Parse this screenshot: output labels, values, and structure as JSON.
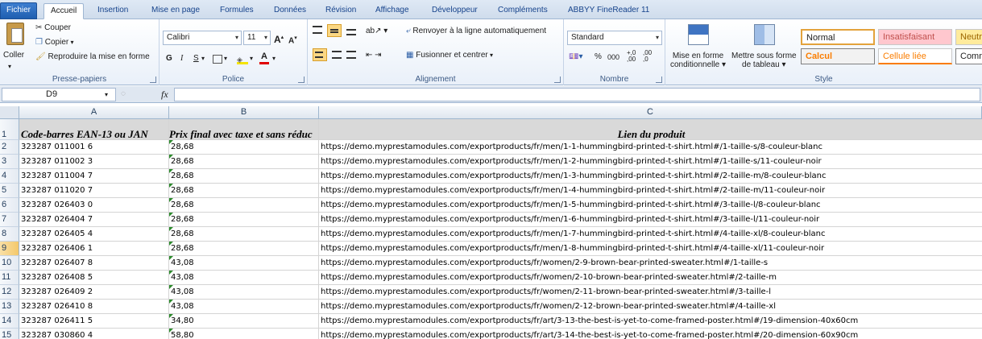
{
  "ribbon_tabs": [
    "Fichier",
    "Accueil",
    "Insertion",
    "Mise en page",
    "Formules",
    "Données",
    "Révision",
    "Affichage",
    "Développeur",
    "Compléments",
    "ABBYY FineReader 11"
  ],
  "clipboard": {
    "paste": "Coller",
    "cut": "Couper",
    "copy": "Copier",
    "format_painter": "Reproduire la mise en forme",
    "label": "Presse-papiers"
  },
  "font": {
    "name": "Calibri",
    "size": "11",
    "bold": "G",
    "italic": "I",
    "underline": "S",
    "label": "Police"
  },
  "alignment": {
    "wrap": "Renvoyer à la ligne automatiquement",
    "merge": "Fusionner et centrer",
    "label": "Alignement"
  },
  "number": {
    "format": "Standard",
    "percent": "%",
    "thousands": "000",
    "label": "Nombre"
  },
  "styles": {
    "cond_format_1": "Mise en forme",
    "cond_format_2": "conditionnelle",
    "table_format_1": "Mettre sous forme",
    "table_format_2": "de tableau",
    "normal": "Normal",
    "bad": "Insatisfaisant",
    "neutral": "Neutr",
    "calc": "Calcul",
    "linked": "Cellule liée",
    "comment": "Comm",
    "label": "Style"
  },
  "formula_bar": {
    "cell_ref": "D9",
    "fx": "fx",
    "value": ""
  },
  "columns": [
    "A",
    "B",
    "C"
  ],
  "selected_row": "9",
  "header_row": {
    "row": "1",
    "a": "Code-barres EAN-13 ou JAN",
    "b": "Prix final avec taxe et sans réduc",
    "c": "Lien du produit"
  },
  "rows": [
    {
      "n": "2",
      "a": "323287 011001 6",
      "b": "28,68",
      "c": "https://demo.myprestamodules.com/exportproducts/fr/men/1-1-hummingbird-printed-t-shirt.html#/1-taille-s/8-couleur-blanc"
    },
    {
      "n": "3",
      "a": "323287 011002 3",
      "b": "28,68",
      "c": "https://demo.myprestamodules.com/exportproducts/fr/men/1-2-hummingbird-printed-t-shirt.html#/1-taille-s/11-couleur-noir"
    },
    {
      "n": "4",
      "a": "323287 011004 7",
      "b": "28,68",
      "c": "https://demo.myprestamodules.com/exportproducts/fr/men/1-3-hummingbird-printed-t-shirt.html#/2-taille-m/8-couleur-blanc"
    },
    {
      "n": "5",
      "a": "323287 011020 7",
      "b": "28,68",
      "c": "https://demo.myprestamodules.com/exportproducts/fr/men/1-4-hummingbird-printed-t-shirt.html#/2-taille-m/11-couleur-noir"
    },
    {
      "n": "6",
      "a": "323287 026403 0",
      "b": "28,68",
      "c": "https://demo.myprestamodules.com/exportproducts/fr/men/1-5-hummingbird-printed-t-shirt.html#/3-taille-l/8-couleur-blanc"
    },
    {
      "n": "7",
      "a": "323287 026404 7",
      "b": "28,68",
      "c": "https://demo.myprestamodules.com/exportproducts/fr/men/1-6-hummingbird-printed-t-shirt.html#/3-taille-l/11-couleur-noir"
    },
    {
      "n": "8",
      "a": "323287 026405 4",
      "b": "28,68",
      "c": "https://demo.myprestamodules.com/exportproducts/fr/men/1-7-hummingbird-printed-t-shirt.html#/4-taille-xl/8-couleur-blanc"
    },
    {
      "n": "9",
      "a": "323287 026406 1",
      "b": "28,68",
      "c": "https://demo.myprestamodules.com/exportproducts/fr/men/1-8-hummingbird-printed-t-shirt.html#/4-taille-xl/11-couleur-noir"
    },
    {
      "n": "10",
      "a": "323287 026407 8",
      "b": "43,08",
      "c": "https://demo.myprestamodules.com/exportproducts/fr/women/2-9-brown-bear-printed-sweater.html#/1-taille-s"
    },
    {
      "n": "11",
      "a": "323287 026408 5",
      "b": "43,08",
      "c": "https://demo.myprestamodules.com/exportproducts/fr/women/2-10-brown-bear-printed-sweater.html#/2-taille-m"
    },
    {
      "n": "12",
      "a": "323287 026409 2",
      "b": "43,08",
      "c": "https://demo.myprestamodules.com/exportproducts/fr/women/2-11-brown-bear-printed-sweater.html#/3-taille-l"
    },
    {
      "n": "13",
      "a": "323287 026410 8",
      "b": "43,08",
      "c": "https://demo.myprestamodules.com/exportproducts/fr/women/2-12-brown-bear-printed-sweater.html#/4-taille-xl"
    },
    {
      "n": "14",
      "a": "323287 026411 5",
      "b": "34,80",
      "c": "https://demo.myprestamodules.com/exportproducts/fr/art/3-13-the-best-is-yet-to-come-framed-poster.html#/19-dimension-40x60cm"
    },
    {
      "n": "15",
      "a": "323287 030860 4",
      "b": "58,80",
      "c": "https://demo.myprestamodules.com/exportproducts/fr/art/3-14-the-best-is-yet-to-come-framed-poster.html#/20-dimension-60x90cm"
    }
  ]
}
